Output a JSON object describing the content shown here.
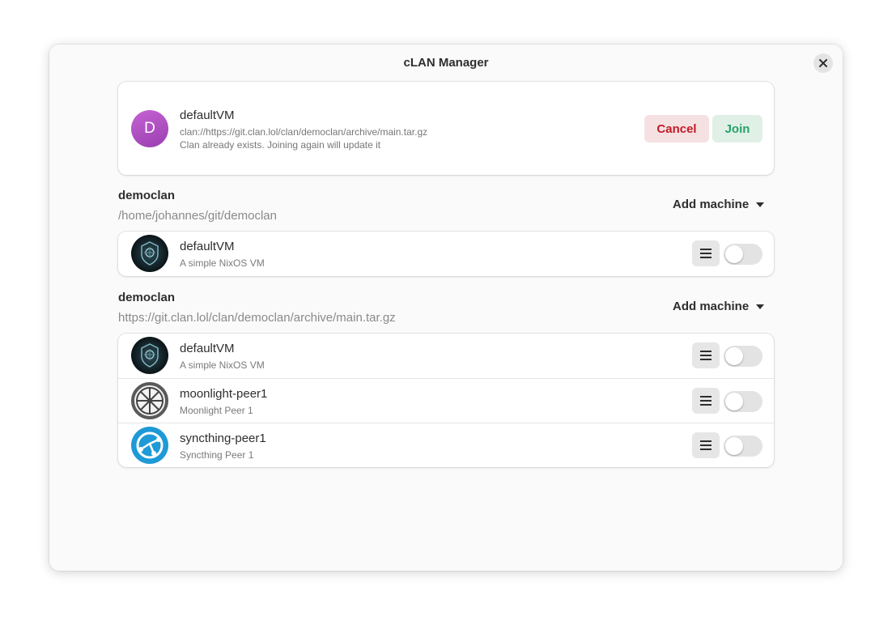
{
  "window": {
    "title": "cLAN Manager"
  },
  "join": {
    "avatar_letter": "D",
    "name": "defaultVM",
    "url": "clan://https://git.clan.lol/clan/democlan/archive/main.tar.gz",
    "note": "Clan already exists. Joining again will update it",
    "cancel_label": "Cancel",
    "join_label": "Join"
  },
  "groups": [
    {
      "title": "democlan",
      "path": "/home/johannes/git/democlan",
      "add_label": "Add machine",
      "machines": [
        {
          "name": "defaultVM",
          "desc": "A simple NixOS VM",
          "icon": "nix-shield-icon",
          "enabled": false
        }
      ]
    },
    {
      "title": "democlan",
      "path": "https://git.clan.lol/clan/democlan/archive/main.tar.gz",
      "add_label": "Add machine",
      "machines": [
        {
          "name": "defaultVM",
          "desc": "A simple NixOS VM",
          "icon": "nix-shield-icon",
          "enabled": false
        },
        {
          "name": "moonlight-peer1",
          "desc": "Moonlight Peer 1",
          "icon": "moonlight-wheel-icon",
          "enabled": false
        },
        {
          "name": "syncthing-peer1",
          "desc": "Syncthing Peer 1",
          "icon": "syncthing-icon",
          "enabled": false
        }
      ]
    }
  ],
  "colors": {
    "cancel": "#c01c28",
    "join": "#26a269",
    "avatar": "#b04fc4"
  }
}
